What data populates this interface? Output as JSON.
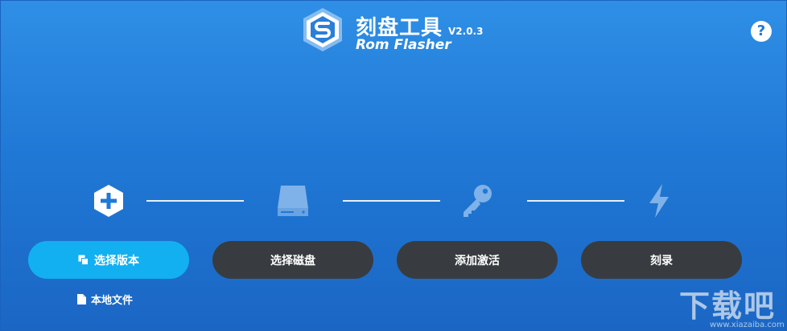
{
  "header": {
    "title_cn": "刻盘工具",
    "title_en": "Rom Flasher",
    "version": "V2.0.3"
  },
  "help": {
    "label": "?"
  },
  "steps": [
    {
      "icon": "plus-hexagon-icon",
      "label": "选择版本",
      "active": true
    },
    {
      "icon": "hard-disk-icon",
      "label": "选择磁盘",
      "active": false
    },
    {
      "icon": "key-icon",
      "label": "添加激活",
      "active": false
    },
    {
      "icon": "lightning-icon",
      "label": "刻录",
      "active": false
    }
  ],
  "local_file": {
    "label": "本地文件"
  },
  "watermark": {
    "text": "下载吧",
    "url": "www.xiazaiba.com"
  },
  "colors": {
    "background_top": "#2f8fe6",
    "background_bottom": "#1b66c4",
    "active_button": "#12b0f1",
    "inactive_button": "#383c40",
    "inactive_icon": "#7fb2e8"
  }
}
